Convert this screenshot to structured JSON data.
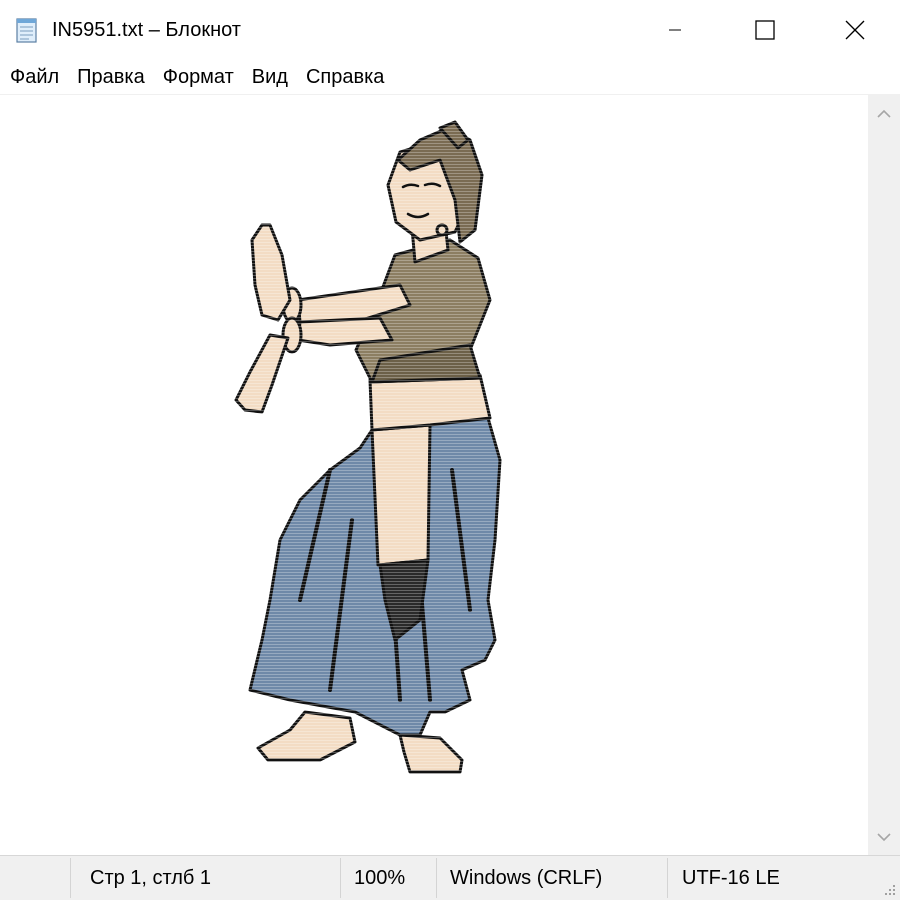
{
  "window": {
    "title": "IN5951.txt – Блокнот",
    "icon": "notepad-icon",
    "controls": [
      "minimize-icon",
      "maximize-icon",
      "close-icon"
    ]
  },
  "menu": {
    "items": [
      {
        "label": "Файл"
      },
      {
        "label": "Правка"
      },
      {
        "label": "Формат"
      },
      {
        "label": "Вид"
      },
      {
        "label": "Справка"
      }
    ]
  },
  "status": {
    "position": "Стр 1, стлб 1",
    "zoom": "100%",
    "line_endings": "Windows (CRLF)",
    "encoding": "UTF-16 LE"
  },
  "colors": {
    "skin": "#f3dcc4",
    "top": "#8c7e62",
    "skirt": "#6f89a8",
    "outline": "#111111",
    "chrome": "#f0f0f0"
  }
}
